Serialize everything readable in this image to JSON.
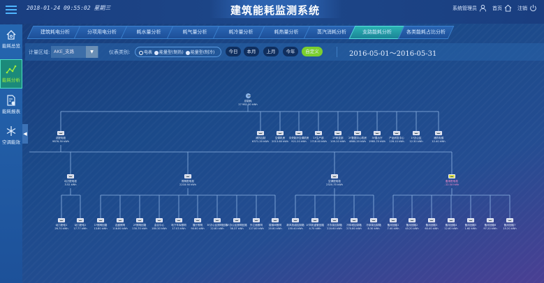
{
  "header": {
    "datetime": "2018-01-24 09:55:02 星期三",
    "title": "建筑能耗监测系统",
    "user": "系统管理员",
    "home": "首页",
    "logout": "注销"
  },
  "tabs": [
    "建筑耗电分析",
    "分项用电分析",
    "耗水量分析",
    "耗气量分析",
    "耗冷量分析",
    "耗热量分析",
    "蒸汽消耗分析",
    "支路能耗分析",
    "各类能耗占比分析"
  ],
  "active_tab": "支路能耗分析",
  "sidebar": [
    {
      "label": "能耗总览",
      "icon": "home-icon"
    },
    {
      "label": "能耗分析",
      "icon": "chart-line-icon"
    },
    {
      "label": "能耗报表",
      "icon": "report-icon"
    },
    {
      "label": "空调能效",
      "icon": "snowflake-icon"
    }
  ],
  "filter": {
    "area_label": "计量区域:",
    "area_value": "AKE_支路",
    "meter_label": "仪表类别:",
    "meter_options": [
      "电表",
      "能量型(制热)",
      "能量型(制冷)"
    ],
    "periods": [
      "今日",
      "本月",
      "上月",
      "今年",
      "自定义"
    ],
    "date_range": "2016-05-01～2016-05-31"
  },
  "tree": {
    "root": {
      "name": "总能耗",
      "value": "27 982.30 kWh"
    },
    "level1": [
      {
        "name": "总配电柜",
        "value": "9876.30 kWh"
      },
      {
        "name": "消防控制",
        "value": "6371.20 kWh"
      },
      {
        "name": "空调机房",
        "value": "2013.60 kWh"
      },
      {
        "name": "中央制冷空调机房",
        "value": "921.20 kWh"
      },
      {
        "name": "1F生产部",
        "value": "1718.40 kWh"
      },
      {
        "name": "2F研发部",
        "value": "109.10 kWh"
      },
      {
        "name": "2F数据中心机房",
        "value": "4880.20 kWh"
      },
      {
        "name": "3F展示厅",
        "value": "1985.70 kWh"
      },
      {
        "name": "产品研发中心",
        "value": "128.10 kWh"
      },
      {
        "name": "1F办公区",
        "value": "12.30 kWh"
      },
      {
        "name": "消防电梯",
        "value": "12.40 kWh"
      }
    ],
    "level2": [
      {
        "name": "动力配电柜",
        "value": "3.52 kWh",
        "alert": false
      },
      {
        "name": "照明配电柜",
        "value": "2218.90 kWh",
        "alert": false
      },
      {
        "name": "空调配电柜",
        "value": "2320.70 kWh",
        "alert": false
      },
      {
        "name": "备用配电柜",
        "value": "-12.50 kWh",
        "alert": true
      }
    ],
    "level3": [
      [
        {
          "name": "动力配电1",
          "value": "26.70 kWh"
        },
        {
          "name": "动力配电2",
          "value": "17.77 kWh"
        }
      ],
      [
        {
          "name": "1F照明回路",
          "value": "13.80 kWh"
        },
        {
          "name": "走廊照明",
          "value": "116.80 kWh"
        },
        {
          "name": "2F照明回路",
          "value": "130.70 kWh"
        },
        {
          "name": "会议中心",
          "value": "180.30 kWh"
        },
        {
          "name": "地下车库照明",
          "value": "17.03 kWh"
        },
        {
          "name": "展厅照明",
          "value": "90.60 kWh"
        },
        {
          "name": "3F办公区照明回路",
          "value": "22.80 kWh"
        },
        {
          "name": "4F办公区照明回路",
          "value": "38.37 kWh"
        },
        {
          "name": "外立面照明",
          "value": "127.80 kWh"
        },
        {
          "name": "楼梯间照明",
          "value": "20.80 kWh"
        }
      ],
      [
        {
          "name": "新风机组控制箱",
          "value": "150.40 kWh"
        },
        {
          "name": "1F风机盘管回路",
          "value": "4.70 kWh"
        },
        {
          "name": "冷冻泵控制箱",
          "value": "220.60 kWh"
        },
        {
          "name": "冷却塔控制箱",
          "value": "270.80 kWh"
        },
        {
          "name": "冷却泵控制箱",
          "value": "8.30 kWh"
        }
      ],
      [
        {
          "name": "备用回路1",
          "value": "7.40 kWh"
        },
        {
          "name": "备用回路2",
          "value": "45.20 kWh"
        },
        {
          "name": "备用回路3",
          "value": "60.40 kWh"
        },
        {
          "name": "备用回路4",
          "value": "12.60 kWh"
        },
        {
          "name": "备用回路5",
          "value": "1.60 kWh"
        },
        {
          "name": "备用回路6",
          "value": "97.20 kWh"
        },
        {
          "name": "备用回路7",
          "value": "15.20 kWh"
        }
      ]
    ]
  }
}
